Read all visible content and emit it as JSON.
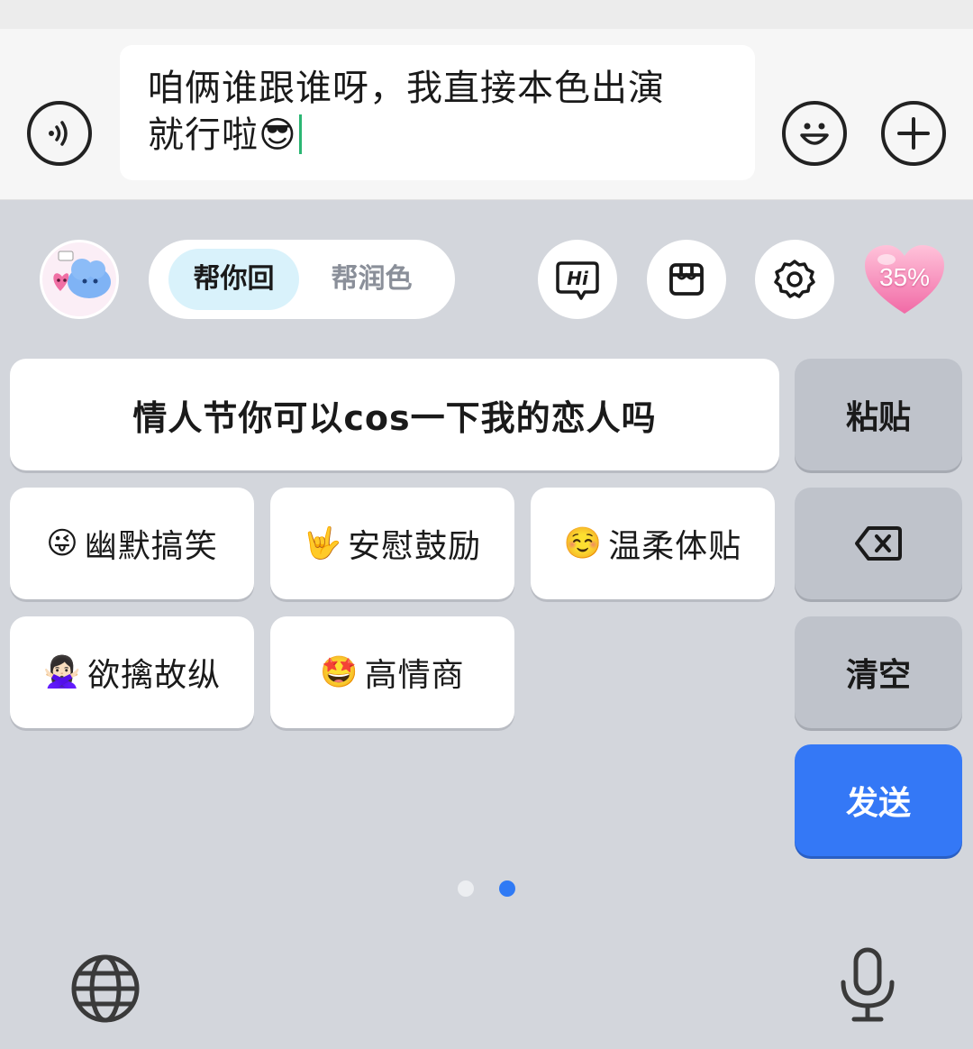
{
  "input": {
    "message_line1": "咱俩谁跟谁呀，我直接本色出演",
    "message_line2": "就行啦",
    "message_emoji": "😎"
  },
  "toolbar": {
    "mode_tabs": [
      {
        "label": "帮你回",
        "active": true
      },
      {
        "label": "帮润色",
        "active": false
      }
    ],
    "icons": [
      "hi-icon",
      "store-icon",
      "settings-gear-icon",
      "heart-progress-icon"
    ],
    "heart_percent": "35%"
  },
  "suggestions": {
    "main": "情人节你可以cos一下我的恋人吗",
    "styles": [
      {
        "emoji": "😜",
        "label": "幽默搞笑"
      },
      {
        "emoji": "🤟",
        "label": "安慰鼓励"
      },
      {
        "emoji": "☺️",
        "label": "温柔体贴"
      },
      {
        "emoji": "🙅🏻‍♀️",
        "label": "欲擒故纵"
      },
      {
        "emoji": "🤩",
        "label": "高情商"
      }
    ]
  },
  "side_keys": {
    "paste": "粘贴",
    "clear": "清空",
    "send": "发送"
  },
  "page_indicator": {
    "current": 2,
    "total": 2
  },
  "colors": {
    "accent": "#3478f6",
    "keyboard_bg": "#d3d6dc",
    "active_tab_bg": "#d9f2fb"
  }
}
